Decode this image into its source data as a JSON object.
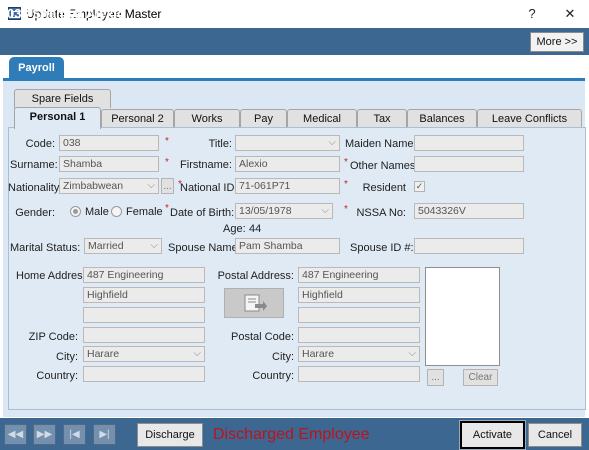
{
  "window": {
    "title": "Update Employee Master",
    "help_label": "?",
    "close_label": "✕"
  },
  "header": {
    "employee": "038 Shamba Alexio",
    "more_button": "More >>"
  },
  "top_tabs": [
    "Payroll"
  ],
  "sub_tabs": [
    "Spare Fields",
    "Personal 1",
    "Personal 2",
    "Works",
    "Pay",
    "Medical",
    "Tax",
    "Balances",
    "Leave Conflicts"
  ],
  "form": {
    "code": {
      "label": "Code:",
      "value": "038"
    },
    "title": {
      "label": "Title:",
      "value": ""
    },
    "maiden_name": {
      "label": "Maiden Name:",
      "value": ""
    },
    "surname": {
      "label": "Surname:",
      "value": "Shamba"
    },
    "firstname": {
      "label": "Firstname:",
      "value": "Alexio"
    },
    "other_names": {
      "label": "Other Names:",
      "value": ""
    },
    "nationality": {
      "label": "Nationality",
      "value": "Zimbabwean",
      "ellipsis": "..."
    },
    "national_id": {
      "label": "National ID:",
      "value": "71-061P71"
    },
    "resident": {
      "label": "Resident",
      "checked": true,
      "check_glyph": "✓"
    },
    "gender": {
      "label": "Gender:",
      "male": "Male",
      "female": "Female",
      "selected": "Male"
    },
    "dob": {
      "label": "Date of Birth:",
      "value": "13/05/1978"
    },
    "nssa": {
      "label": "NSSA No:",
      "value": "5043326V"
    },
    "age": {
      "label": "Age:",
      "value": "44"
    },
    "marital_status": {
      "label": "Marital Status:",
      "value": "Married"
    },
    "spouse_name": {
      "label": "Spouse Name:",
      "value": "Pam Shamba"
    },
    "spouse_id": {
      "label": "Spouse ID #:",
      "value": ""
    },
    "home_address": {
      "label": "Home Address:",
      "line1": "487 Engineering",
      "line2": "Highfield",
      "line3": ""
    },
    "postal_address": {
      "label": "Postal Address:",
      "line1": "487 Engineering",
      "line2": "Highfield",
      "line3": ""
    },
    "zip_code": {
      "label": "ZIP Code:",
      "value": ""
    },
    "postal_code": {
      "label": "Postal Code:",
      "value": ""
    },
    "city": {
      "label": "City:",
      "value": "Harare"
    },
    "postal_city": {
      "label": "City:",
      "value": "Harare"
    },
    "country": {
      "label": "Country:",
      "value": ""
    },
    "postal_country": {
      "label": "Country:",
      "value": ""
    },
    "required_marker": "*",
    "photo_browse": "...",
    "photo_clear": "Clear"
  },
  "footer": {
    "nav_first": "◀◀",
    "nav_next_alt": "▶▶",
    "nav_start": "|◀",
    "nav_end": "▶|",
    "discharge_button": "Discharge",
    "status_text": "Discharged Employee",
    "activate_button": "Activate",
    "cancel_button": "Cancel"
  },
  "colors": {
    "header": "#3b6791",
    "tab_accent": "#2f7db8",
    "panel": "#dfeaf5",
    "status_red": "#c0121a"
  }
}
